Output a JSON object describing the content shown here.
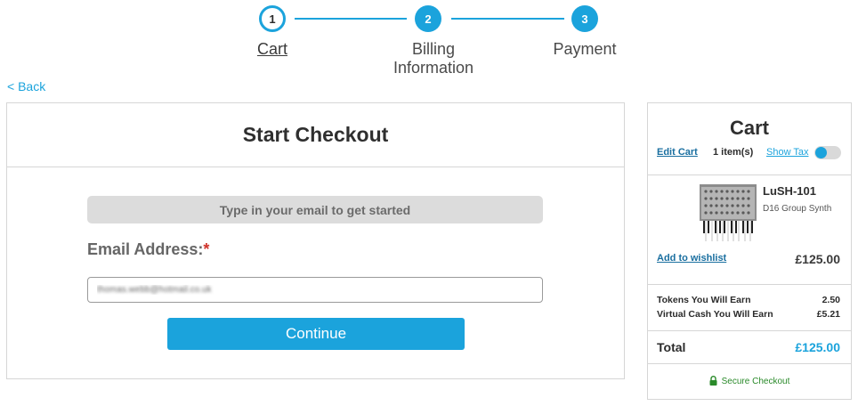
{
  "stepper": {
    "steps": [
      {
        "number": "1",
        "label": "Cart"
      },
      {
        "number": "2",
        "label": "Billing\nInformation"
      },
      {
        "number": "3",
        "label": "Payment"
      }
    ]
  },
  "nav": {
    "back_label": "< Back"
  },
  "checkout": {
    "title": "Start Checkout",
    "hint": "Type in your email to get started",
    "email_label": "Email Address:",
    "required_marker": "*",
    "email_value": "thomas.webb@hotmail.co.uk",
    "continue_label": "Continue"
  },
  "cart": {
    "title": "Cart",
    "edit_label": "Edit Cart",
    "item_count": "1 item(s)",
    "show_tax_label": "Show Tax",
    "show_tax_on": false,
    "product": {
      "name": "LuSH-101",
      "description": "D16 Group Synth",
      "price": "£125.00",
      "wishlist_label": "Add to wishlist"
    },
    "earnings": [
      {
        "label": "Tokens You Will Earn",
        "value": "2.50"
      },
      {
        "label": "Virtual Cash You Will Earn",
        "value": "£5.21"
      }
    ],
    "total_label": "Total",
    "total_value": "£125.00",
    "secure_label": "Secure Checkout"
  },
  "colors": {
    "accent": "#1ba3dc",
    "link_dark": "#1a6fa0",
    "required": "#d0342c",
    "secure": "#2a8a2a"
  }
}
